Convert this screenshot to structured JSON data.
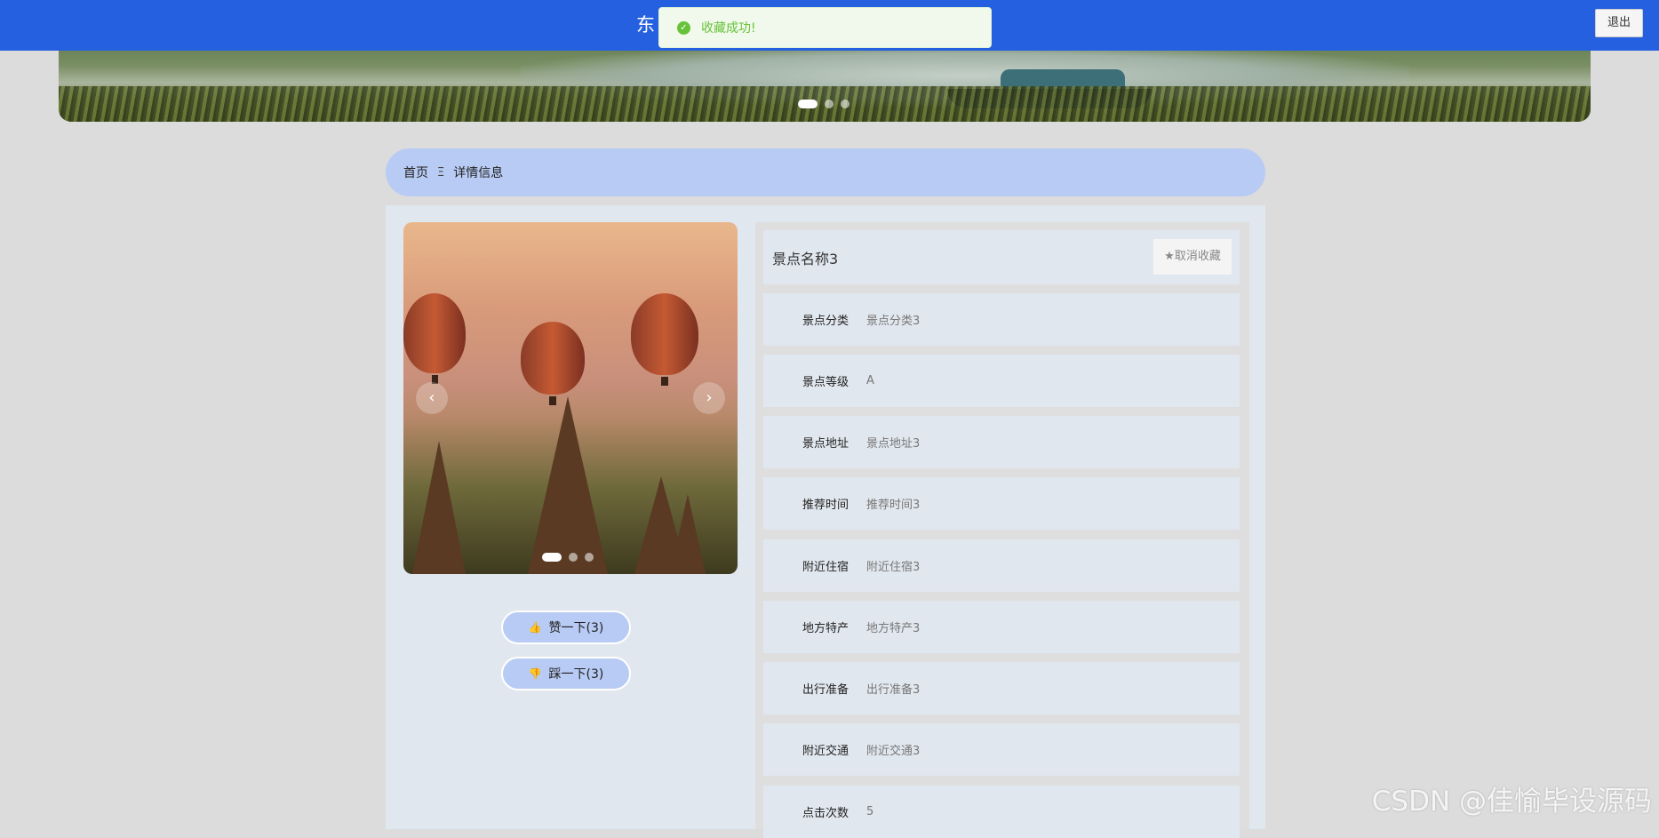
{
  "header": {
    "site_title": "东",
    "logout_label": "退出"
  },
  "toast": {
    "icon": "check-circle-icon",
    "message": "收藏成功!"
  },
  "breadcrumb": {
    "home": "首页",
    "separator": "Ξ",
    "current": "详情信息"
  },
  "gallery": {
    "prev_icon": "‹",
    "next_icon": "›"
  },
  "actions": {
    "like_label": "赞一下(3)",
    "dislike_label": "踩一下(3)",
    "like_icon": "thumbs-up-icon",
    "dislike_icon": "thumbs-down-icon"
  },
  "detail": {
    "name": "景点名称3",
    "favorite_label": "★取消收藏",
    "fields": [
      {
        "label": "景点分类",
        "value": "景点分类3"
      },
      {
        "label": "景点等级",
        "value": "A"
      },
      {
        "label": "景点地址",
        "value": "景点地址3"
      },
      {
        "label": "推荐时间",
        "value": "推荐时间3"
      },
      {
        "label": "附近住宿",
        "value": "附近住宿3"
      },
      {
        "label": "地方特产",
        "value": "地方特产3"
      },
      {
        "label": "出行准备",
        "value": "出行准备3"
      },
      {
        "label": "附近交通",
        "value": "附近交通3"
      },
      {
        "label": "点击次数",
        "value": "5"
      }
    ]
  },
  "watermark": "CSDN @佳愉毕设源码",
  "colors": {
    "topbar": "#2560e0",
    "accent_light": "#b8cbf4",
    "panel_bg": "#e1e7ee",
    "success": "#67c23a"
  }
}
